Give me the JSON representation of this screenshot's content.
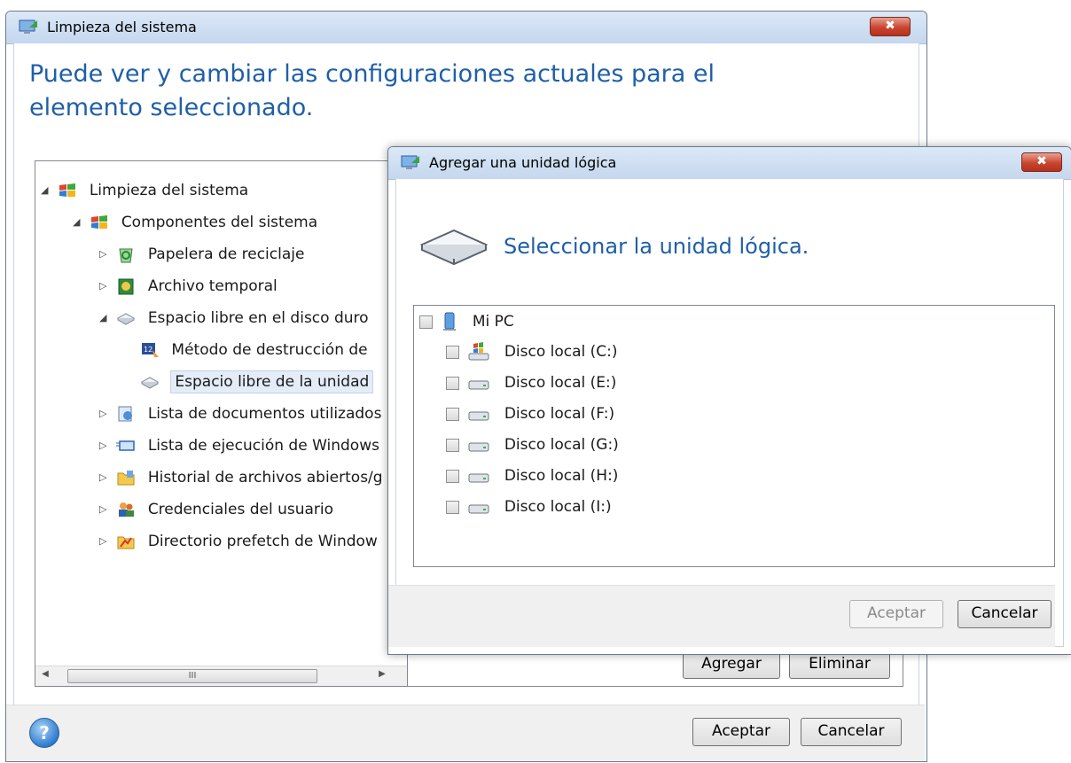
{
  "main_window": {
    "title": "Limpieza del sistema",
    "close_label": "✖",
    "headline": "Puede ver y cambiar las configuraciones actuales para el elemento seleccionado.",
    "tree": [
      {
        "label": "Limpieza del sistema",
        "expanded": true,
        "icon": "windows-flag-icon"
      },
      {
        "label": "Componentes del sistema",
        "expanded": true,
        "icon": "windows-flag-icon"
      },
      {
        "label": "Papelera de reciclaje",
        "expanded": false,
        "icon": "recycle-bin-icon"
      },
      {
        "label": "Archivo temporal",
        "expanded": false,
        "icon": "temp-file-icon"
      },
      {
        "label": "Espacio libre en el disco duro",
        "expanded": true,
        "icon": "drive-icon"
      },
      {
        "label": "Método de destrucción de",
        "icon": "calendar-icon"
      },
      {
        "label": "Espacio libre de la unidad",
        "selected": true,
        "icon": "drive-icon"
      },
      {
        "label": "Lista de documentos utilizados",
        "expanded": false,
        "icon": "documents-icon"
      },
      {
        "label": "Lista de ejecución de Windows",
        "expanded": false,
        "icon": "run-icon"
      },
      {
        "label": "Historial de archivos abiertos/g",
        "expanded": false,
        "icon": "folder-icon"
      },
      {
        "label": "Credenciales del usuario",
        "expanded": false,
        "icon": "users-icon"
      },
      {
        "label": "Directorio prefetch de Window",
        "expanded": false,
        "icon": "prefetch-folder-icon"
      }
    ],
    "scroll_thumb": "III",
    "add_button": "Agregar",
    "remove_button": "Eliminar",
    "ok_button": "Aceptar",
    "cancel_button": "Cancelar"
  },
  "dialog": {
    "title": "Agregar una unidad lógica",
    "close_label": "✖",
    "heading": "Seleccionar la unidad lógica.",
    "root_item": "Mi PC",
    "drives": [
      {
        "label": "Disco local (C:)",
        "icon": "system-drive-icon"
      },
      {
        "label": "Disco local (E:)",
        "icon": "hard-drive-icon"
      },
      {
        "label": "Disco local (F:)",
        "icon": "hard-drive-icon"
      },
      {
        "label": "Disco local (G:)",
        "icon": "hard-drive-icon"
      },
      {
        "label": "Disco local (H:)",
        "icon": "hard-drive-icon"
      },
      {
        "label": "Disco local (I:)",
        "icon": "hard-drive-icon"
      }
    ],
    "ok_button": "Aceptar",
    "cancel_button": "Cancelar"
  },
  "colors": {
    "heading_blue": "#1f5fa8",
    "close_red": "#c9452f",
    "selection": "#e4ecf7"
  }
}
